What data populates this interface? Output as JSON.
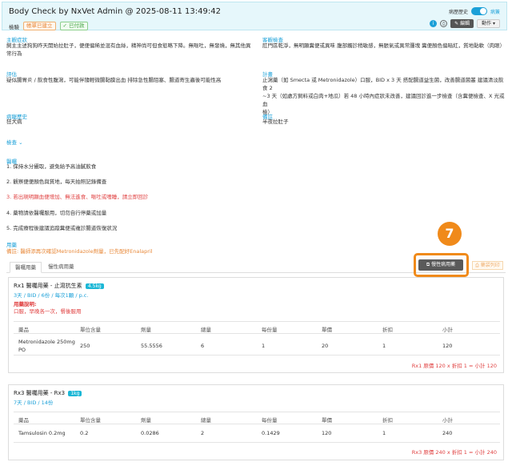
{
  "header": {
    "title": "Body Check by NxVet Admin @ 2025-08-11 13:49:42",
    "type": "檢驗",
    "tag1": "帳單已建立",
    "tag2": "✓ 已付款",
    "history_label": "病歷歷史",
    "view_label": "病簽",
    "edit_label": "編輯",
    "actions_label": "動作 ▾"
  },
  "soap": {
    "chief_label": "主觀症狀",
    "chief_text": [
      "飼主主述狗狗昨天開始拉肚子，便便偏稀並混有血絲，精神尚可但食慾略下降。無嘔吐，無發燒，無其他異",
      "常行為"
    ],
    "objective_label": "客觀檢查",
    "objective_text": "肛門區乾淨，無明顯糞便或異味 腹部觸診稍敏感，無脹氣或異常腫塊 糞便顏色偏暗紅，質地黏軟（肉眼）",
    "assess_label": "評估",
    "assess_text": "疑似腸胃炎 / 飲食性腹瀉，可能伴隨輕微腸黏膜出血 排除急性腸阻塞、腸道寄生蟲後可能性高",
    "plan_label": "計畫",
    "plan_text": [
      "止瀉藥（如 Smecta 或 Metronidazole）口服，BID x 3 天 搭配腸道益生菌，改善腸道菌叢 建議清淡飲食 2",
      "~3 天（如處方飼料或白肉+地瓜）若 48 小時內症狀未改善，建議回診進一步檢查（含糞便檢查、X 光或血",
      "檢）"
    ],
    "history_label": "病寵歷史",
    "history_text": "狂犬病",
    "remark_label": "備註",
    "remark_text": "半夜拉肚子",
    "more_label": "檢查 ⌄"
  },
  "advice": {
    "label": "醫囑",
    "items": [
      "1. 保持水分攝取，避免給予高油膩飲食",
      "2. 觀察便便顏色與質地，每天拍照記錄備查",
      "3. 若出現明顯血便增加、無法進食、嘔吐或嗜睡，請立即回診",
      "4. 藥物請依醫囑服用，切勿自行停藥或加量",
      "5. 完成療程後建議追蹤糞便或複診腸道恢復狀況"
    ]
  },
  "medication": {
    "label": "用藥",
    "note": "備註: 醫師添再次確認Metronidazole劑量，已先配好Enalapril",
    "tab1": "醫囑用藥",
    "tab2": "慢性病用藥",
    "chronic_btn": "慢性病用藥",
    "reprint": "藥袋列印",
    "step": "7"
  },
  "rx1": {
    "title": "Rx1 醫囑用藥 - 止瀉抗生素",
    "qty": "4.5kg",
    "freq": "3天 / BID / 6份 / 每次1顆 / p.c.",
    "usage_label": "用藥說明:",
    "usage_text": "口服，早晚各一次，餐後服用",
    "columns": [
      "藥品",
      "單位含量",
      "劑量",
      "總量",
      "每份量",
      "單價",
      "折扣",
      "小計"
    ],
    "row": [
      "Metronidazole 250mg PO",
      "250",
      "55.5556",
      "6",
      "1",
      "20",
      "1",
      "120"
    ],
    "total": "Rx1 原價 120 x 折扣 1 = 小計 120"
  },
  "rx3": {
    "title": "Rx3 醫囑用藥 - Rx3",
    "qty": "1kg",
    "freq": "7天 / BID / 14份",
    "columns": [
      "藥品",
      "單位含量",
      "劑量",
      "總量",
      "每份量",
      "單價",
      "折扣",
      "小計"
    ],
    "row": [
      "Tamsulosin 0.2mg",
      "0.2",
      "0.0286",
      "2",
      "0.1429",
      "120",
      "1",
      "240"
    ],
    "total": "Rx3 原價 240 x 折扣 1 = 小計 240"
  }
}
